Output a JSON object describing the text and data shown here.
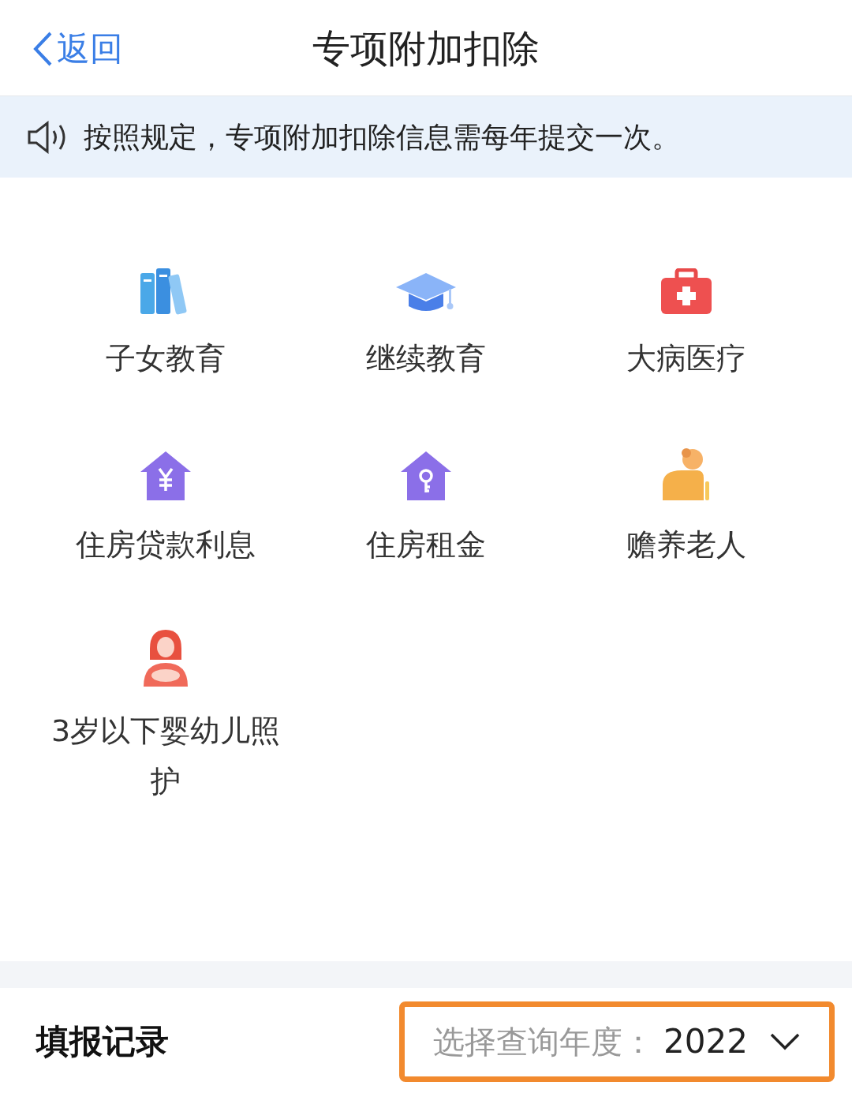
{
  "header": {
    "back_label": "返回",
    "title": "专项附加扣除"
  },
  "notice": {
    "text": "按照规定，专项附加扣除信息需每年提交一次。"
  },
  "items": [
    {
      "kind": "books",
      "label": "子女教育"
    },
    {
      "kind": "cap",
      "label": "继续教育"
    },
    {
      "kind": "medkit",
      "label": "大病医疗"
    },
    {
      "kind": "house_yen",
      "label": "住房贷款利息"
    },
    {
      "kind": "house_key",
      "label": "住房租金"
    },
    {
      "kind": "elder",
      "label": "赡养老人"
    },
    {
      "kind": "mother",
      "label": "3岁以下婴幼儿照护"
    }
  ],
  "records": {
    "title": "填报记录",
    "year_selector": {
      "label": "选择查询年度：",
      "value": "2022",
      "highlighted": true
    }
  }
}
